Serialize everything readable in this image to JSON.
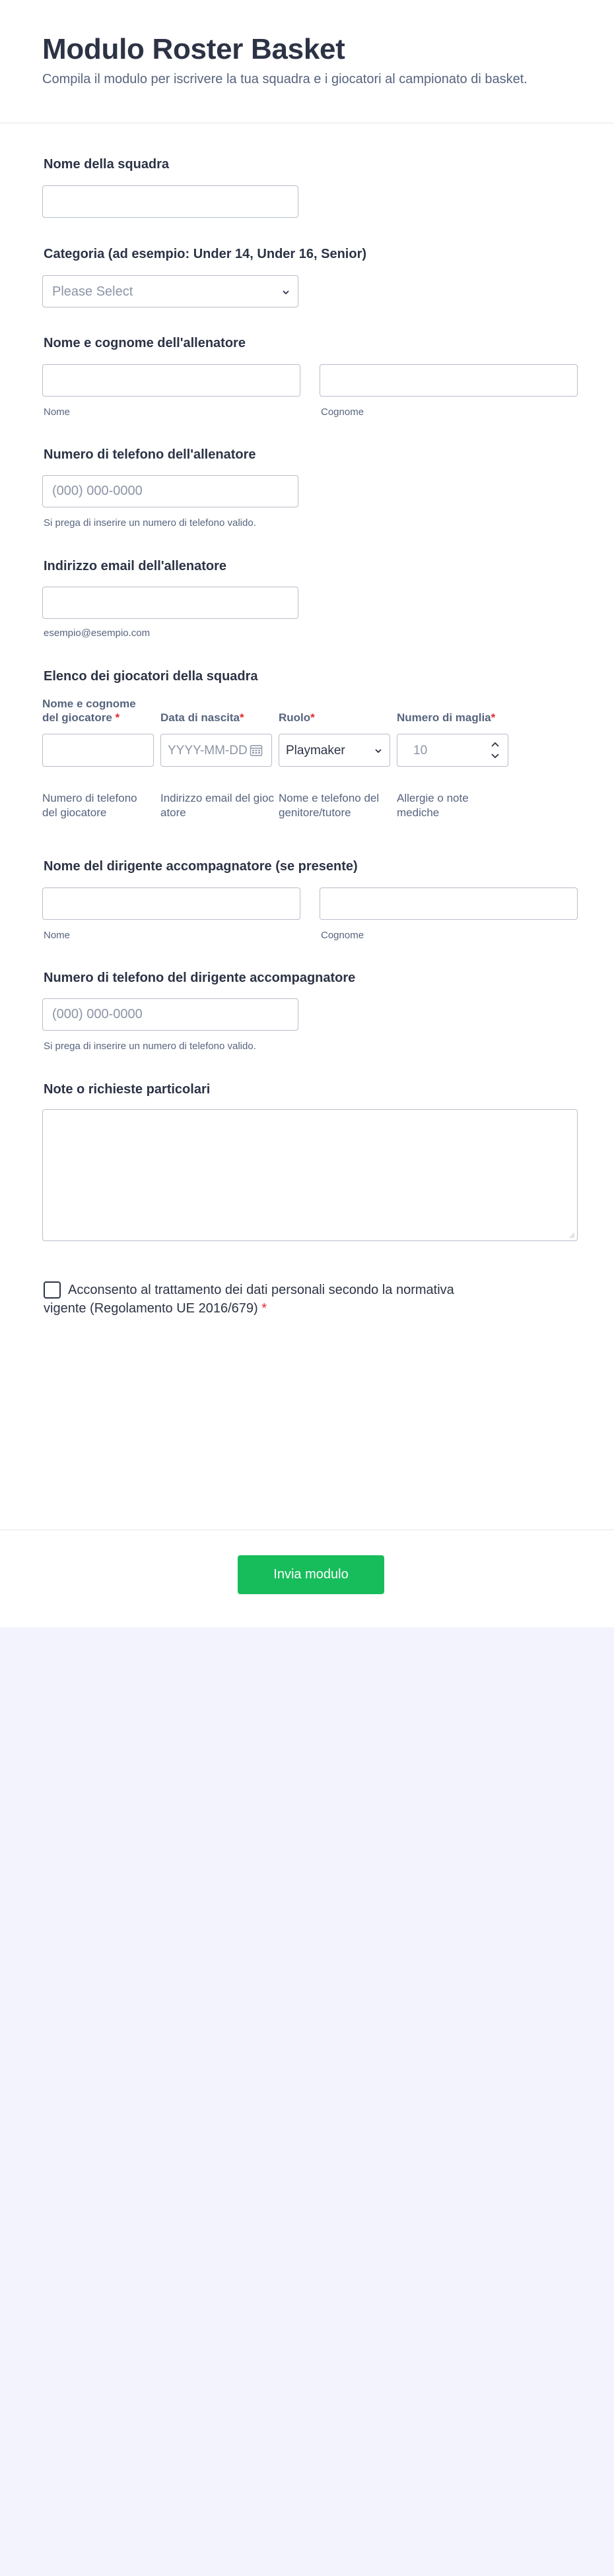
{
  "header": {
    "title": "Modulo Roster Basket",
    "subtitle": "Compila il modulo per iscrivere la tua squadra e i giocatori al campionato di basket."
  },
  "team": {
    "label": "Nome della squadra"
  },
  "category": {
    "label": "Categoria (ad esempio: Under 14, Under 16, Senior)",
    "placeholder": "Please Select"
  },
  "coach_name": {
    "label": "Nome e cognome dell'allenatore",
    "first_sublabel": "Nome",
    "last_sublabel": "Cognome"
  },
  "coach_phone": {
    "label": "Numero di telefono dell'allenatore",
    "placeholder": "(000) 000-0000",
    "hint": "Si prega di inserire un numero di telefono valido."
  },
  "coach_email": {
    "label": "Indirizzo email dell'allenatore",
    "hint": "esempio@esempio.com"
  },
  "players": {
    "label": "Elenco dei giocatori della squadra",
    "columns": [
      "Nome e cognome del giocatore",
      "Data di nascita",
      "Ruolo",
      "Numero di maglia"
    ],
    "required_mark": "*",
    "date_placeholder": "YYYY-MM-DD",
    "role_value": "Playmaker",
    "number_placeholder": "10",
    "more_columns": [
      "Numero di telefono del giocatore",
      "Indirizzo email del giocatore",
      "Nome e telefono del genitore/tutore",
      "Allergie o note mediche"
    ]
  },
  "manager": {
    "label": "Nome del dirigente accompagnatore (se presente)",
    "first_sublabel": "Nome",
    "last_sublabel": "Cognome"
  },
  "manager_phone": {
    "label": "Numero di telefono del dirigente accompagnatore",
    "placeholder": "(000) 000-0000",
    "hint": "Si prega di inserire un numero di telefono valido."
  },
  "notes": {
    "label": "Note o richieste particolari"
  },
  "consent": {
    "text": "Acconsento al trattamento dei dati personali secondo la normativa vigente (Regolamento UE 2016/679)",
    "required_mark": "*"
  },
  "submit_label": "Invia modulo",
  "colors": {
    "accent": "#18bd5b",
    "required": "#e0282b",
    "text": "#2c3345",
    "page_bg": "#f3f3fe"
  }
}
